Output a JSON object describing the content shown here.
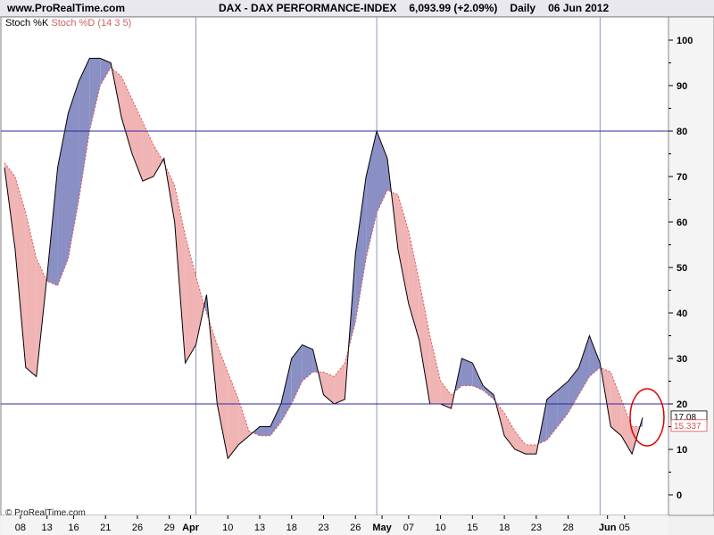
{
  "header": {
    "site": "www.ProRealTime.com",
    "instrument": "DAX - DAX PERFORMANCE-INDEX",
    "price": "6,093.99 (+2.09%)",
    "period": "Daily",
    "date": "06 Jun 2012"
  },
  "legend": {
    "k_label": "Stoch %K",
    "d_label": "Stoch %D (14 3 5)"
  },
  "footer": {
    "copyright": "© ProRealTime.com"
  },
  "colors": {
    "k_line": "#000000",
    "d_line": "#e05050",
    "fill_k_above": "#8a8fc4",
    "fill_d_above": "#f0b4b4",
    "level_lines": "#2a2aa0",
    "month_lines": "#8a9ab8",
    "annotation": "#e00000"
  },
  "chart_data": {
    "type": "line",
    "ylim": [
      -5,
      103
    ],
    "y_ticks": [
      "0",
      "10",
      "20",
      "30",
      "40",
      "50",
      "60",
      "70",
      "80",
      "90",
      "100"
    ],
    "x_ticks": [
      {
        "label": "08",
        "i": 1.5,
        "bold": false
      },
      {
        "label": "13",
        "i": 4,
        "bold": false
      },
      {
        "label": "16",
        "i": 6.5,
        "bold": false
      },
      {
        "label": "21",
        "i": 9.5,
        "bold": false
      },
      {
        "label": "26",
        "i": 12.5,
        "bold": false
      },
      {
        "label": "29",
        "i": 15.5,
        "bold": false
      },
      {
        "label": "Apr",
        "i": 17.5,
        "bold": true
      },
      {
        "label": "10",
        "i": 21,
        "bold": false
      },
      {
        "label": "13",
        "i": 24,
        "bold": false
      },
      {
        "label": "18",
        "i": 27,
        "bold": false
      },
      {
        "label": "23",
        "i": 30,
        "bold": false
      },
      {
        "label": "26",
        "i": 33,
        "bold": false
      },
      {
        "label": "May",
        "i": 35.5,
        "bold": true
      },
      {
        "label": "07",
        "i": 38,
        "bold": false
      },
      {
        "label": "10",
        "i": 41,
        "bold": false
      },
      {
        "label": "15",
        "i": 44,
        "bold": false
      },
      {
        "label": "18",
        "i": 47,
        "bold": false
      },
      {
        "label": "23",
        "i": 50,
        "bold": false
      },
      {
        "label": "28",
        "i": 53,
        "bold": false
      },
      {
        "label": "Jun",
        "i": 56.7,
        "bold": true
      },
      {
        "label": "05",
        "i": 58.3,
        "bold": false
      }
    ],
    "month_separators": [
      18,
      35,
      56
    ],
    "levels": [
      80,
      20
    ],
    "series": [
      {
        "name": "Stoch %K",
        "values": [
          72,
          54,
          28,
          26,
          48,
          72,
          84,
          91,
          96,
          96,
          95,
          83,
          75,
          69,
          70,
          74,
          60,
          29,
          33,
          44,
          20,
          8,
          11,
          13,
          15,
          15,
          20,
          30,
          33,
          32,
          22,
          20,
          21,
          53,
          70,
          80,
          74,
          54,
          42,
          34,
          20,
          20,
          19,
          30,
          29,
          24,
          22,
          13,
          10,
          9,
          9,
          21,
          23,
          25,
          28,
          35,
          29,
          15,
          13,
          9,
          17
        ]
      },
      {
        "name": "Stoch %D (14 3 5)",
        "values": [
          73,
          70,
          62,
          52,
          47,
          46,
          52,
          65,
          80,
          90,
          94,
          92,
          87,
          82,
          77,
          73,
          68,
          57,
          48,
          40,
          33,
          27,
          21,
          14,
          13,
          13,
          16,
          20,
          25,
          27,
          27,
          26,
          29,
          38,
          52,
          62,
          67,
          66,
          58,
          47,
          35,
          25,
          22,
          24,
          24,
          23,
          21,
          18,
          14,
          11,
          11,
          12,
          15,
          18,
          22,
          26,
          28,
          27,
          21,
          15,
          15
        ]
      }
    ],
    "last_values": {
      "k": "17.08",
      "d": "15.337"
    }
  }
}
